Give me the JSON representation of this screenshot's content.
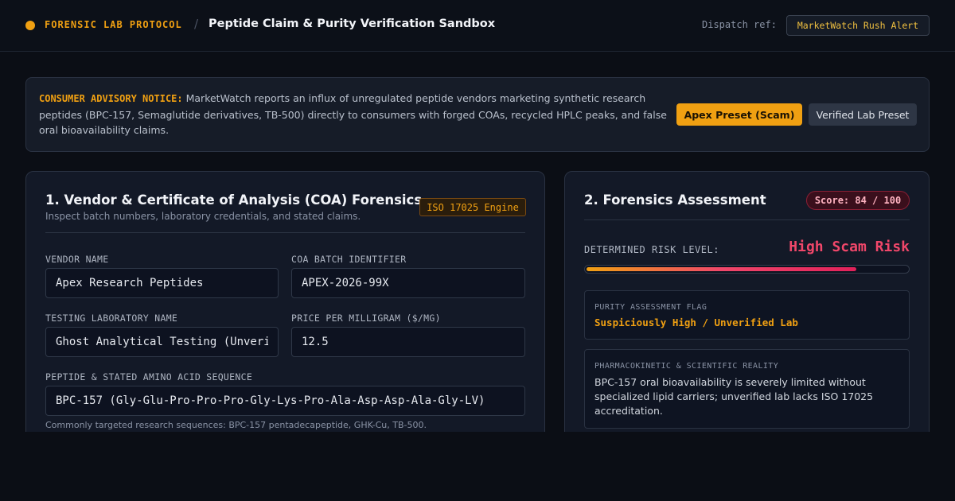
{
  "header": {
    "brand": "FORENSIC LAB PROTOCOL",
    "separator": "/",
    "title": "Peptide Claim & Purity Verification Sandbox",
    "dispatch_label": "Dispatch ref:",
    "dispatch_value": "MarketWatch Rush Alert",
    "accent_color": "#f0a012"
  },
  "advisory": {
    "label": "CONSUMER ADVISORY NOTICE:",
    "text": "MarketWatch reports an influx of unregulated peptide vendors marketing synthetic research peptides (BPC-157, Semaglutide derivatives, TB-500) directly to consumers with forged COAs, recycled HPLC peaks, and false oral bioavailability claims.",
    "preset_scam_label": "Apex Preset (Scam)",
    "preset_verified_label": "Verified Lab Preset"
  },
  "coa_panel": {
    "title": "1. Vendor & Certificate of Analysis (COA) Forensics",
    "subtitle": "Inspect batch numbers, laboratory credentials, and stated claims.",
    "badge": "ISO 17025 Engine",
    "fields": {
      "vendor_name": {
        "label": "VENDOR NAME",
        "value": "Apex Research Peptides"
      },
      "batch_id": {
        "label": "COA BATCH IDENTIFIER",
        "value": "APEX-2026-99X"
      },
      "lab_name": {
        "label": "TESTING LABORATORY NAME",
        "value": "Ghost Analytical Testing (Unverified)"
      },
      "price": {
        "label": "PRICE PER MILLIGRAM ($/MG)",
        "value": "12.5"
      },
      "sequence": {
        "label": "PEPTIDE & STATED AMINO ACID SEQUENCE",
        "value": "BPC-157 (Gly-Glu-Pro-Pro-Pro-Gly-Lys-Pro-Ala-Asp-Asp-Ala-Gly-LV)"
      }
    },
    "sequence_hint": "Commonly targeted research sequences: BPC-157 pentadecapeptide, GHK-Cu, TB-500."
  },
  "assessment": {
    "title": "2. Forensics Assessment",
    "score_text": "Score: 84 / 100",
    "score_value": 84,
    "score_max": 100,
    "risk_label": "DETERMINED RISK LEVEL:",
    "risk_value": "High Scam Risk",
    "risk_color": "#f0476a",
    "purity_card": {
      "title": "PURITY ASSESSMENT FLAG",
      "value": "Suspiciously High / Unverified Lab"
    },
    "pk_card": {
      "title": "PHARMACOKINETIC & SCIENTIFIC REALITY",
      "text": "BPC-157 oral bioavailability is severely limited without specialized lipid carriers; unverified lab lacks ISO 17025 accreditation."
    }
  }
}
